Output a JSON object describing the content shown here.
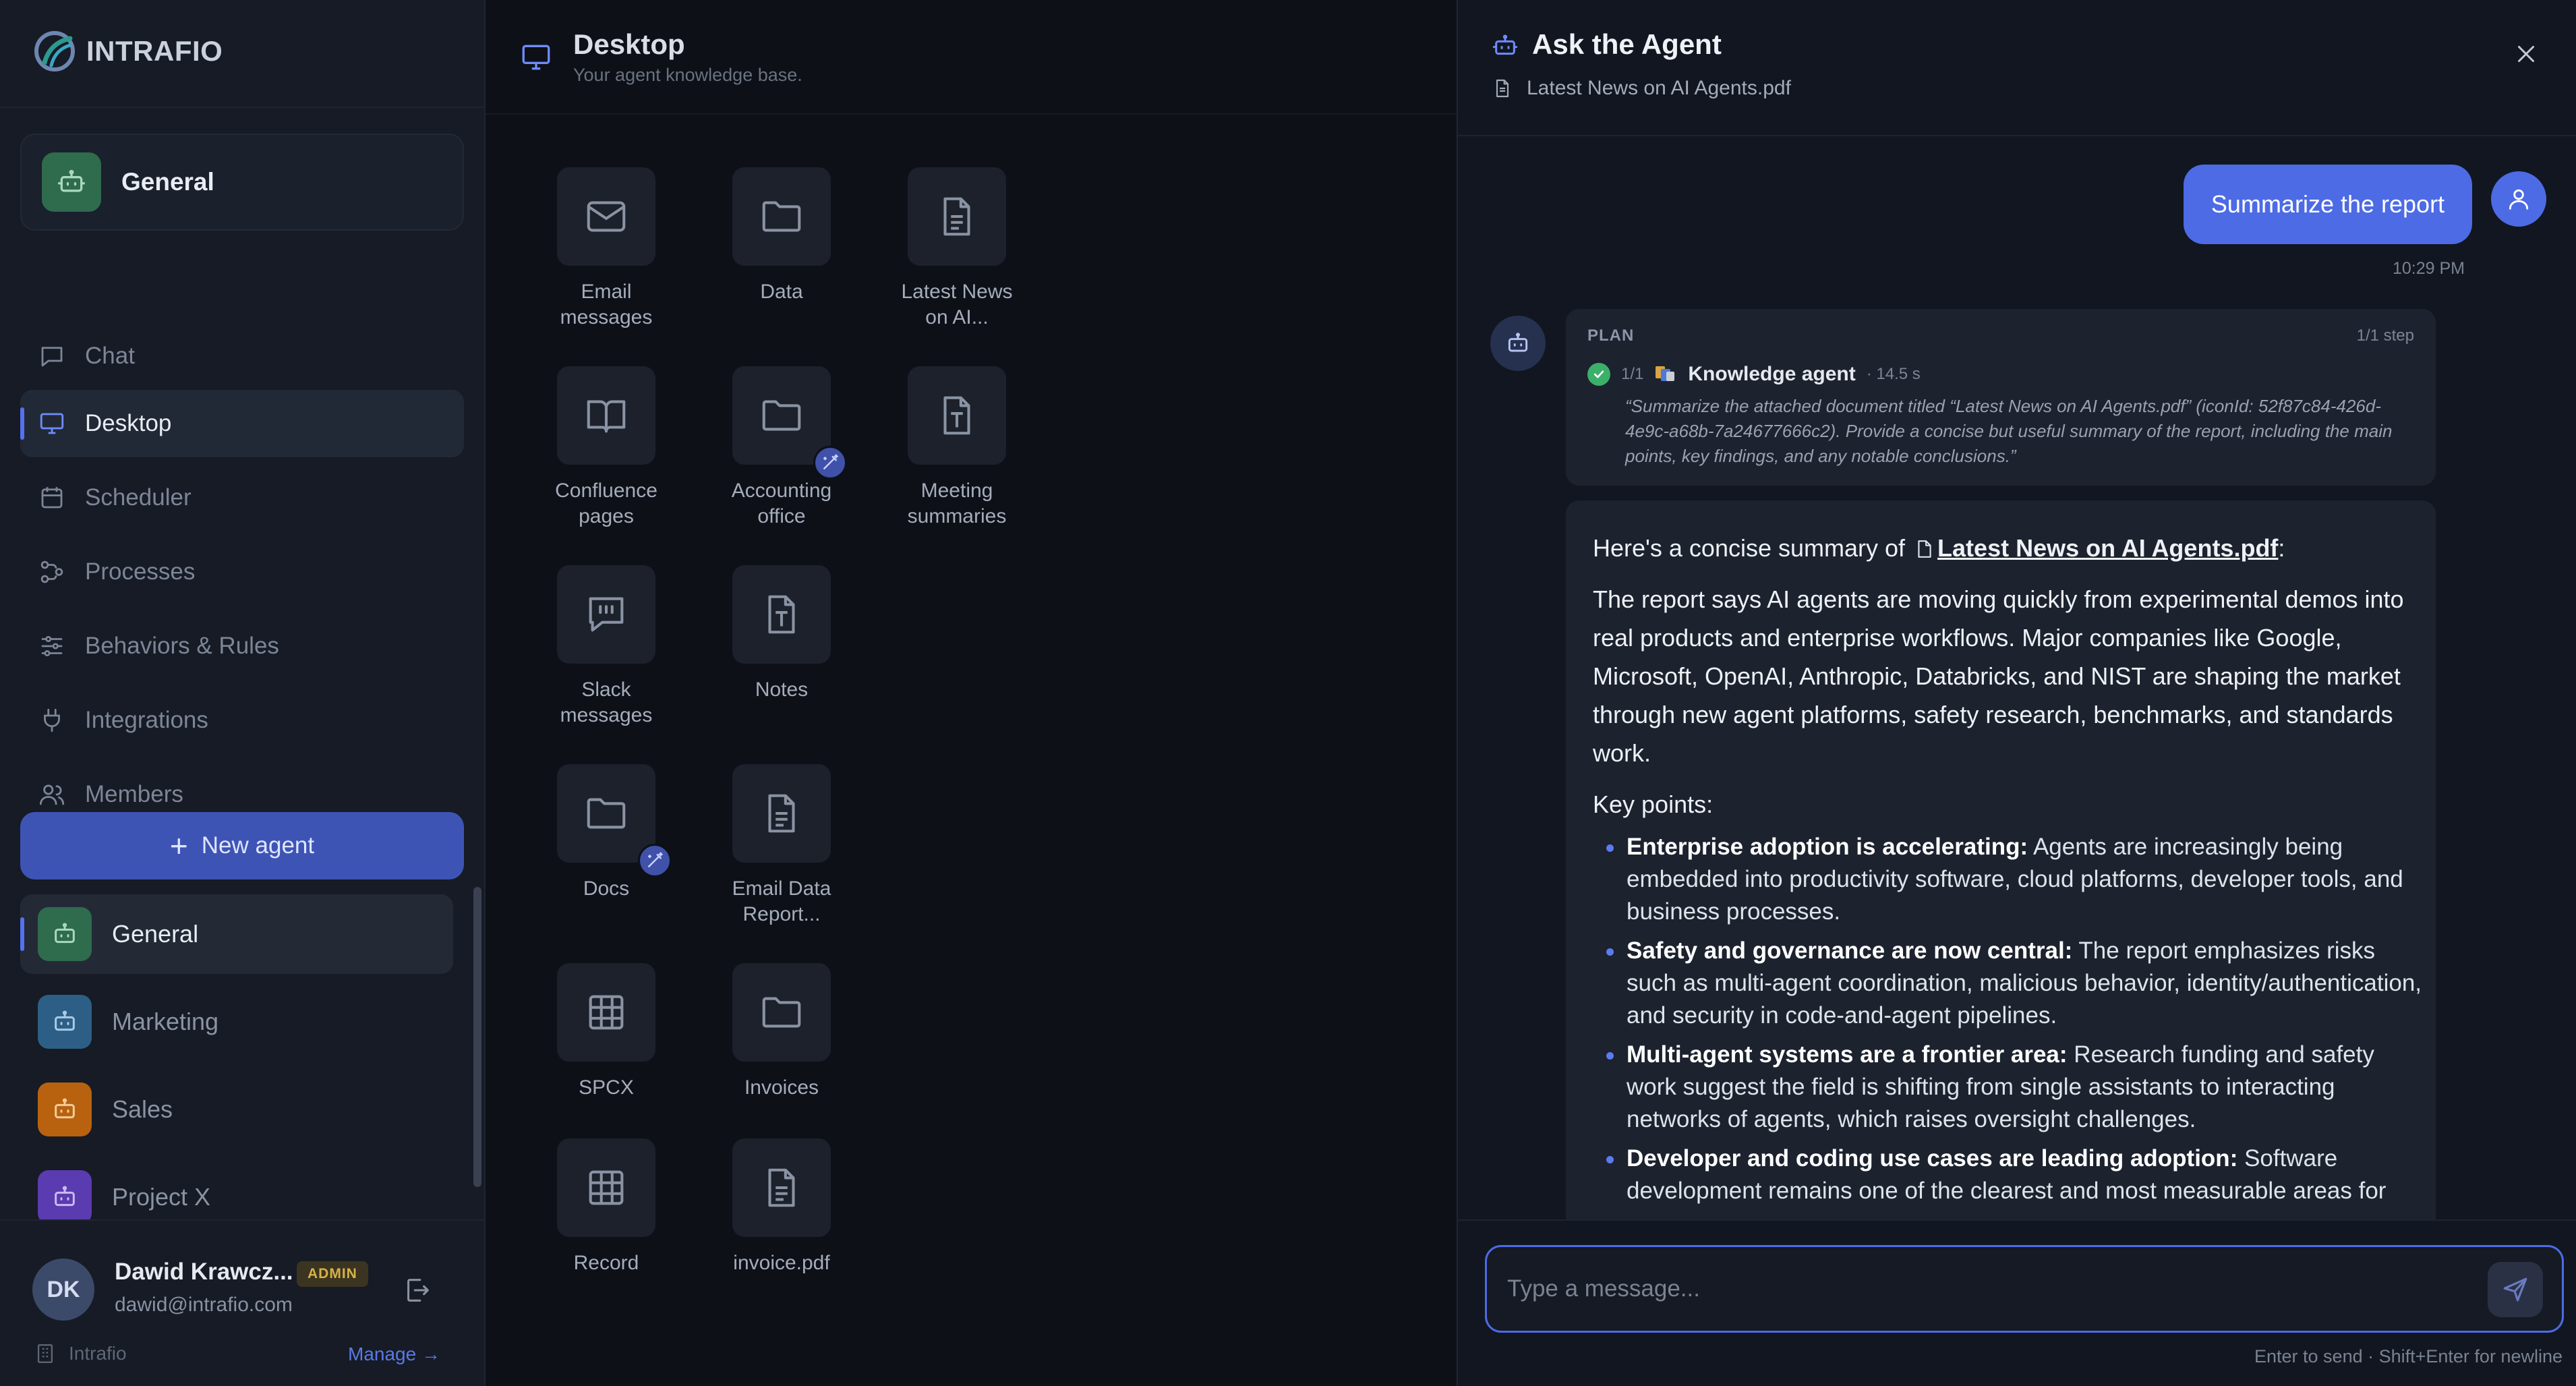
{
  "brand": {
    "name": "INTRAFIO"
  },
  "workspace": {
    "label": "General",
    "color": "#2f6b4d"
  },
  "nav": {
    "items": [
      {
        "label": "Chat",
        "icon": "chat-icon",
        "active": false
      },
      {
        "label": "Desktop",
        "icon": "monitor-icon",
        "active": true
      },
      {
        "label": "Scheduler",
        "icon": "calendar-icon",
        "active": false
      },
      {
        "label": "Processes",
        "icon": "workflow-icon",
        "active": false
      },
      {
        "label": "Behaviors & Rules",
        "icon": "sliders-icon",
        "active": false
      },
      {
        "label": "Integrations",
        "icon": "plug-icon",
        "active": false
      },
      {
        "label": "Members",
        "icon": "users-icon",
        "active": false
      }
    ]
  },
  "new_agent": {
    "label": "New agent"
  },
  "agents": [
    {
      "label": "General",
      "color": "#2f6b4d",
      "active": true
    },
    {
      "label": "Marketing",
      "color": "#2d5f86",
      "active": false
    },
    {
      "label": "Sales",
      "color": "#b8620f",
      "active": false
    },
    {
      "label": "Project X",
      "color": "#5a3bb0",
      "active": false
    }
  ],
  "user": {
    "initials": "DK",
    "name": "Dawid Krawcz...",
    "badge": "ADMIN",
    "email": "dawid@intrafio.com",
    "org": "Intrafio",
    "manage": "Manage →"
  },
  "desktop": {
    "title": "Desktop",
    "subtitle": "Your agent knowledge base.",
    "items": [
      {
        "label1": "Email",
        "label2": "messages",
        "icon": "mail-icon"
      },
      {
        "label1": "Data",
        "label2": "",
        "icon": "folder-icon"
      },
      {
        "label1": "Latest News",
        "label2": "on AI...",
        "icon": "document-icon"
      },
      {
        "label1": "Confluence",
        "label2": "pages",
        "icon": "book-icon"
      },
      {
        "label1": "Accounting",
        "label2": "office",
        "icon": "folder-icon",
        "badge": "magic-wand-icon"
      },
      {
        "label1": "Meeting",
        "label2": "summaries",
        "icon": "text-file-icon"
      },
      {
        "label1": "Slack",
        "label2": "messages",
        "icon": "quote-icon"
      },
      {
        "label1": "Notes",
        "label2": "",
        "icon": "text-file-icon"
      },
      {
        "label1": "Docs",
        "label2": "",
        "icon": "folder-icon",
        "badge": "magic-wand-icon"
      },
      {
        "label1": "Email Data",
        "label2": "Report...",
        "icon": "document-icon"
      },
      {
        "label1": "SPCX",
        "label2": "",
        "icon": "table-icon"
      },
      {
        "label1": "Invoices",
        "label2": "",
        "icon": "folder-icon"
      },
      {
        "label1": "Record",
        "label2": "",
        "icon": "table-icon"
      },
      {
        "label1": "invoice.pdf",
        "label2": "",
        "icon": "document-icon"
      }
    ]
  },
  "panel": {
    "title": "Ask the Agent",
    "file": "Latest News on AI Agents.pdf",
    "user_message": "Summarize the report",
    "time": "10:29 PM",
    "plan": {
      "label": "PLAN",
      "steps": "1/1 step",
      "index": "1/1",
      "agent": "Knowledge agent",
      "duration": "· 14.5 s",
      "quote": "“Summarize the attached document titled “Latest News on AI Agents.pdf” (iconId: 52f87c84-426d-4e9c-a68b-7a24677666c2). Provide a concise but useful summary of the report, including the main points, key findings, and any notable conclusions.”"
    },
    "answer": {
      "intro_prefix": "Here's a concise summary of",
      "intro_link": "Latest News on AI Agents.pdf",
      "intro_suffix": ":",
      "paragraph": "The report says AI agents are moving quickly from experimental demos into real products and enterprise workflows. Major companies like Google, Microsoft, OpenAI, Anthropic, Databricks, and NIST are shaping the market through new agent platforms, safety research, benchmarks, and standards work.",
      "key_points_label": "Key points:",
      "points": [
        {
          "title": "Enterprise adoption is accelerating:",
          "text": " Agents are increasingly being embedded into productivity software, cloud platforms, developer tools, and business processes."
        },
        {
          "title": "Safety and governance are now central:",
          "text": " The report emphasizes risks such as multi-agent coordination, malicious behavior, identity/authentication, and security in code-and-agent pipelines."
        },
        {
          "title": "Multi-agent systems are a frontier area:",
          "text": " Research funding and safety work suggest the field is shifting from single assistants to interacting networks of agents, which raises oversight challenges."
        },
        {
          "title": "Developer and coding use cases are leading adoption:",
          "text": " Software development remains one of the clearest and most measurable areas for"
        }
      ]
    },
    "composer": {
      "placeholder": "Type a message...",
      "hint": "Enter to send · Shift+Enter for newline"
    }
  },
  "colors": {
    "accent": "#4d6be5",
    "success": "#3bb06a",
    "admin_badge": "#d6b247"
  }
}
